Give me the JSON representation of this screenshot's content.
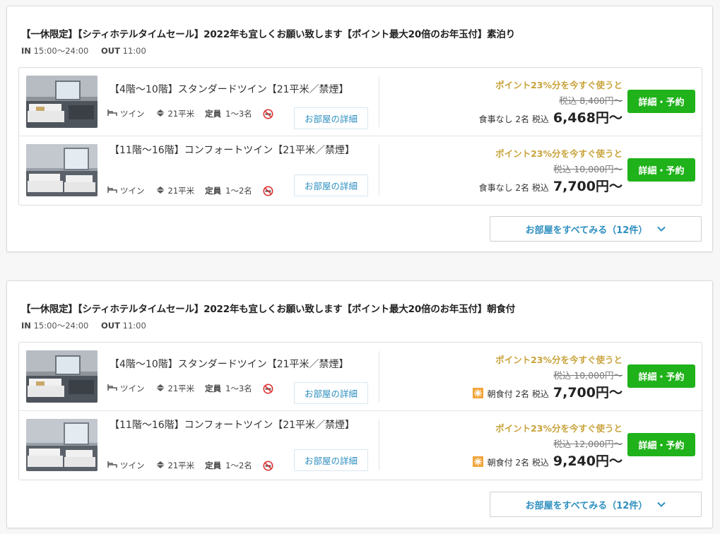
{
  "plans": [
    {
      "title": "【一休限定】【シティホテルタイムセール】2022年も宜しくお願い致します【ポイント最大20倍のお年玉付】素泊り",
      "in_label": "IN",
      "in_time": "15:00〜24:00",
      "out_label": "OUT",
      "out_time": "11:00",
      "rooms": [
        {
          "name": "【4階〜10階】スタンダードツイン【21平米／禁煙】",
          "bed": "ツイン",
          "size": "21平米",
          "cap_label": "定員",
          "cap": "1〜3名",
          "detail": "お部屋の詳細",
          "points": "ポイント23%分を今すぐ使うと",
          "was": "税込 8,400円〜",
          "meal": "食事なし",
          "guests": "2名",
          "tax": "税込",
          "price": "6,468円〜",
          "book": "詳細・予約"
        },
        {
          "name": "【11階〜16階】コンフォートツイン【21平米／禁煙】",
          "bed": "ツイン",
          "size": "21平米",
          "cap_label": "定員",
          "cap": "1〜2名",
          "detail": "お部屋の詳細",
          "points": "ポイント23%分を今すぐ使うと",
          "was": "税込 10,000円〜",
          "meal": "食事なし",
          "guests": "2名",
          "tax": "税込",
          "price": "7,700円〜",
          "book": "詳細・予約"
        }
      ],
      "see_all": "お部屋をすべてみる（12件）"
    },
    {
      "title": "【一休限定】【シティホテルタイムセール】2022年も宜しくお願い致します【ポイント最大20倍のお年玉付】朝食付",
      "in_label": "IN",
      "in_time": "15:00〜24:00",
      "out_label": "OUT",
      "out_time": "11:00",
      "rooms": [
        {
          "name": "【4階〜10階】スタンダードツイン【21平米／禁煙】",
          "bed": "ツイン",
          "size": "21平米",
          "cap_label": "定員",
          "cap": "1〜3名",
          "detail": "お部屋の詳細",
          "points": "ポイント23%分を今すぐ使うと",
          "was": "税込 10,000円〜",
          "meal": "朝食付",
          "guests": "2名",
          "tax": "税込",
          "price": "7,700円〜",
          "book": "詳細・予約"
        },
        {
          "name": "【11階〜16階】コンフォートツイン【21平米／禁煙】",
          "bed": "ツイン",
          "size": "21平米",
          "cap_label": "定員",
          "cap": "1〜2名",
          "detail": "お部屋の詳細",
          "points": "ポイント23%分を今すぐ使うと",
          "was": "税込 12,000円〜",
          "meal": "朝食付",
          "guests": "2名",
          "tax": "税込",
          "price": "9,240円〜",
          "book": "詳細・予約"
        }
      ],
      "see_all": "お部屋をすべてみる（12件）"
    }
  ],
  "icons": {
    "bed": "bed-icon",
    "size": "room-size-icon",
    "no_smoking": "no-smoking-icon",
    "breakfast": "breakfast-icon",
    "chevron": "chevron-down-icon"
  },
  "colors": {
    "points_gold": "#c8a33b",
    "book_green": "#1fb21a",
    "link_blue": "#2e8fc0",
    "breakfast_orange": "#f2a43a"
  }
}
